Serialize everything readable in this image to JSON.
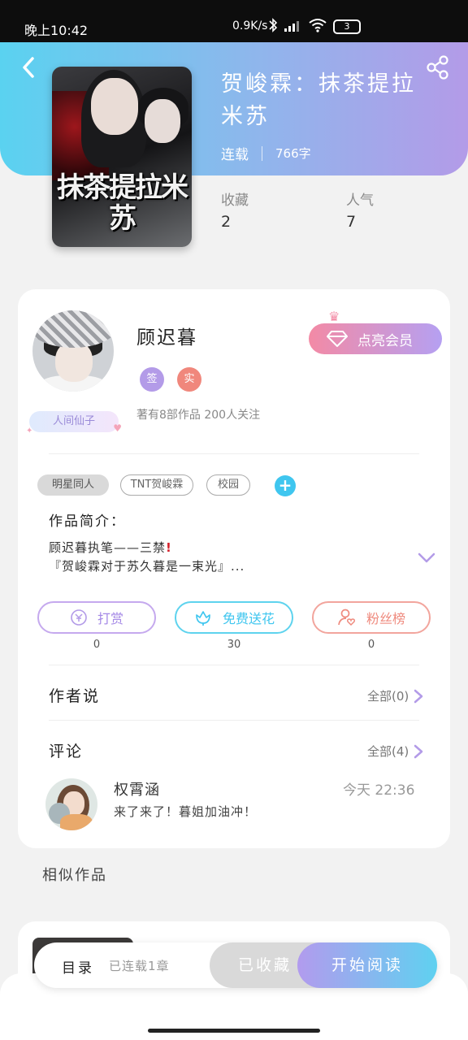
{
  "status_bar": {
    "time": "晚上10:42",
    "net_speed": "0.9K/s",
    "battery": "3"
  },
  "book": {
    "cover_title": "抹茶提拉米苏",
    "title": "贺峻霖：抹茶提拉米苏",
    "status": "连载",
    "words": "766字",
    "favorites_label": "收藏",
    "favorites_value": "2",
    "popularity_label": "人气",
    "popularity_value": "7"
  },
  "author": {
    "name": "顾迟暮",
    "badge": "人间仙子",
    "tag_1": "签",
    "tag_2": "实",
    "info": "著有8部作品 200人关注",
    "vip_button": "点亮会员"
  },
  "tags": [
    "明星同人",
    "TNT贺峻霖",
    "校园"
  ],
  "intro": {
    "title": "作品简介：",
    "line1": "顾迟暮执笔——三禁",
    "line2": "『贺峻霖对于苏久暮是一束光』..."
  },
  "actions": {
    "reward_label": "打赏",
    "reward_count": "0",
    "flower_label": "免费送花",
    "flower_count": "30",
    "fans_label": "粉丝榜",
    "fans_count": "0"
  },
  "author_says": {
    "title": "作者说",
    "link": "全部(0)"
  },
  "comments": {
    "title": "评论",
    "link": "全部(4)",
    "items": [
      {
        "user": "权霄涵",
        "time": "今天 22:36",
        "text": "来了来了！暮姐加油冲！"
      }
    ]
  },
  "similar": {
    "title": "相似作品"
  },
  "bottom": {
    "toc": "目录",
    "toc_status": "已连载1章",
    "collected": "已收藏",
    "read": "开始阅读"
  },
  "colors": {
    "header_gradient_start": "#5ad2f0",
    "header_gradient_end": "#b39be8",
    "vip_pink": "#f38aa5",
    "accent_purple": "#b39be8",
    "accent_cyan": "#3fc6ef",
    "accent_red": "#f0877c"
  }
}
